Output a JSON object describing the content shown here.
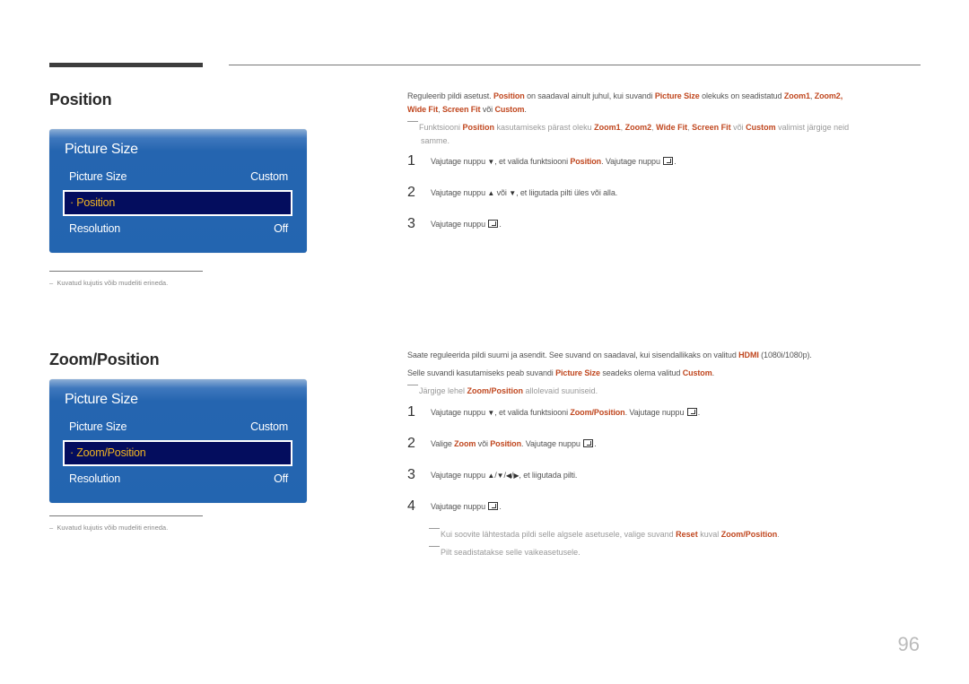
{
  "section1": {
    "title": "Position",
    "osd": {
      "header": "Picture Size",
      "row1_label": "Picture Size",
      "row1_value": "Custom",
      "selected_label": "Position",
      "row3_label": "Resolution",
      "row3_value": "Off"
    },
    "footnote": "Kuvatud kujutis võib mudeliti erineda.",
    "intro": {
      "p1": "Reguleerib pildi asetust. ",
      "p1_hl1": "Position",
      "p2": " on saadaval ainult juhul, kui suvandi ",
      "p2_hl": "Picture Size",
      "p3": " olekuks on seadistatud ",
      "p3_hl1": "Zoom1",
      "p3_sep": ", ",
      "p3_hl2": "Zoom2",
      "p3_end": ",",
      "l2_hl1": "Wide Fit",
      "l2_sep": ", ",
      "l2_hl2": "Screen Fit",
      "l2_mid": " või ",
      "l2_hl3": "Custom",
      "l2_end": "."
    },
    "hint": {
      "t1": "Funktsiooni ",
      "h1": "Position",
      "t2": " kasutamiseks pärast oleku ",
      "h2": "Zoom1",
      "s1": ", ",
      "h3": "Zoom2",
      "s2": ", ",
      "h4": "Wide Fit",
      "s3": ", ",
      "h5": "Screen Fit",
      "t3": " või ",
      "h6": "Custom",
      "t4": " valimist järgige neid",
      "l2": "samme."
    },
    "steps": [
      {
        "num": "1",
        "a": "Vajutage nuppu ",
        "b": ", et valida funktsiooni ",
        "hl": "Position",
        "c": ". Vajutage nuppu ",
        "d": "."
      },
      {
        "num": "2",
        "a": "Vajutage nuppu ",
        "b": " või ",
        "c": ", et liigutada pilti üles või alla."
      },
      {
        "num": "3",
        "a": "Vajutage nuppu ",
        "b": "."
      }
    ]
  },
  "section2": {
    "title": "Zoom/Position",
    "osd": {
      "header": "Picture Size",
      "row1_label": "Picture Size",
      "row1_value": "Custom",
      "selected_label": "Zoom/Position",
      "row3_label": "Resolution",
      "row3_value": "Off"
    },
    "footnote": "Kuvatud kujutis võib mudeliti erineda.",
    "intro": {
      "l1a": "Saate reguleerida pildi suumi ja asendit. See suvand on saadaval, kui sisendallikaks on valitud ",
      "l1_hl": "HDMI",
      "l1b": " (1080i/1080p).",
      "l2a": "Selle suvandi kasutamiseks peab suvandi ",
      "l2_hl1": "Picture Size",
      "l2b": " seadeks olema valitud ",
      "l2_hl2": "Custom",
      "l2c": "."
    },
    "hint": {
      "t1": "Järgige lehel ",
      "h1": "Zoom/Position",
      "t2": " allolevaid suuniseid."
    },
    "steps": [
      {
        "num": "1",
        "a": "Vajutage nuppu ",
        "b": ", et valida funktsiooni ",
        "hl": "Zoom/Position",
        "c": ". Vajutage nuppu ",
        "d": "."
      },
      {
        "num": "2",
        "a": "Valige ",
        "hl1": "Zoom",
        "b": " või ",
        "hl2": "Position",
        "c": ". Vajutage nuppu ",
        "d": "."
      },
      {
        "num": "3",
        "a": "Vajutage nuppu ",
        "sep": "/",
        "b": ", et liigutada pilti."
      },
      {
        "num": "4",
        "a": "Vajutage nuppu ",
        "b": "."
      }
    ],
    "notes": [
      {
        "t1": "Kui soovite lähtestada pildi selle algsele asetusele, valige suvand ",
        "h1": "Reset",
        "t2": " kuval ",
        "h2": "Zoom/Position",
        "t3": "."
      },
      {
        "t1": "Pilt seadistatakse selle vaikeasetusele."
      }
    ]
  },
  "icons": {
    "down": "▼",
    "up": "▲",
    "left": "◀",
    "right": "▶"
  },
  "page_number": "96",
  "colors": {
    "highlight": "#c0471f",
    "osd_blue": "#2365b0",
    "osd_selected": "#040d5e",
    "osd_selected_text": "#f0b422"
  }
}
